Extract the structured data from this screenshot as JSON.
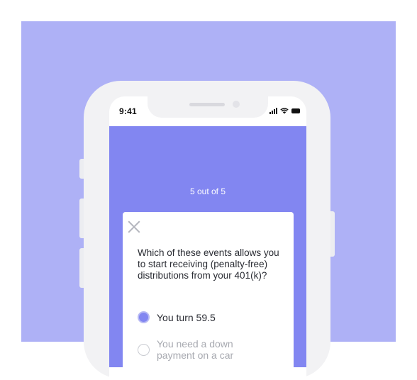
{
  "status_bar": {
    "time": "9:41"
  },
  "quiz": {
    "progress": "5 out of 5",
    "question": "Which of these events allows you to start receiving (penalty-free) distributions from your 401(k)?",
    "options": [
      {
        "label": "You turn 59.5",
        "selected": true
      },
      {
        "label": "You need a down payment on a car",
        "selected": false
      }
    ]
  },
  "colors": {
    "background": "#aeb1f6",
    "app_accent": "#8286f1",
    "phone_frame": "#f2f2f4"
  }
}
